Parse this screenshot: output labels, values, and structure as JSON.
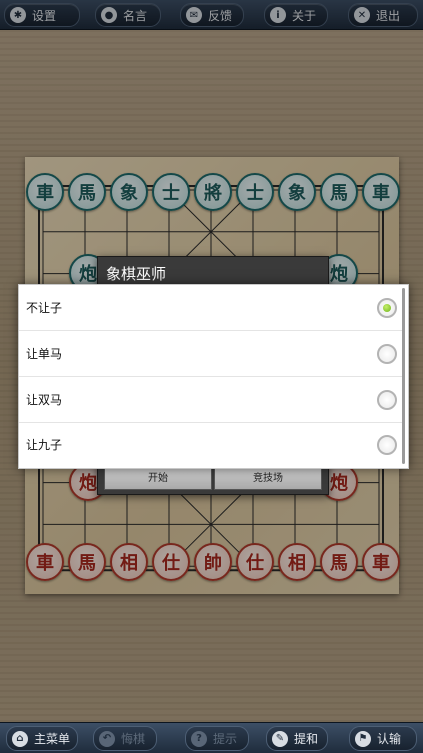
{
  "top_bar": {
    "settings": "设置",
    "quotes": "名言",
    "feedback": "反馈",
    "about": "关于",
    "exit": "退出"
  },
  "board": {
    "black_back_row": [
      "車",
      "馬",
      "象",
      "士",
      "將",
      "士",
      "象",
      "馬",
      "車"
    ],
    "black_cannons": [
      "炮",
      "炮"
    ],
    "red_back_row": [
      "車",
      "馬",
      "相",
      "仕",
      "帥",
      "仕",
      "相",
      "馬",
      "車"
    ],
    "red_cannons": [
      "炮",
      "炮"
    ]
  },
  "background_dialog": {
    "title": "象棋巫师",
    "start_button": "开始",
    "arena_button": "竞技场"
  },
  "handicap_dialog": {
    "options": [
      {
        "label": "不让子",
        "selected": true
      },
      {
        "label": "让单马",
        "selected": false
      },
      {
        "label": "让双马",
        "selected": false
      },
      {
        "label": "让九子",
        "selected": false
      }
    ]
  },
  "bottom_bar": {
    "main_menu": "主菜单",
    "undo": "悔棋",
    "hint": "提示",
    "draw": "提和",
    "resign": "认输"
  },
  "colors": {
    "bar": "#1f2c3c",
    "radio_selected": "#7ab51d",
    "black_piece": "#1d5c5c",
    "red_piece": "#a8281e"
  }
}
